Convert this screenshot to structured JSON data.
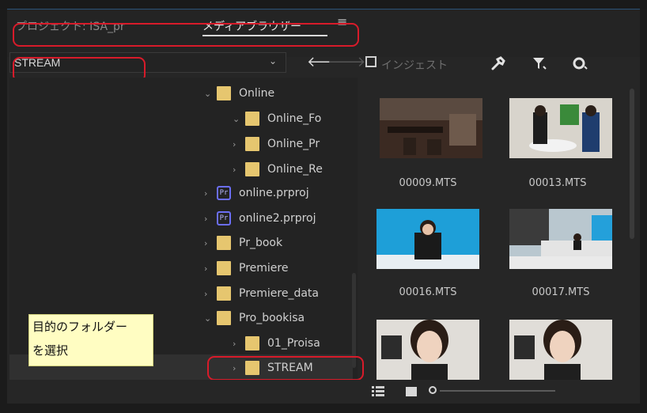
{
  "tabs": {
    "project": "プロジェクト: ISA_pr",
    "media_browser": "メディアブラウザー"
  },
  "toolbar": {
    "path_value": "STREAM",
    "ingest_label": "インジェスト",
    "menu_icon": "hamburger-menu-icon",
    "back_icon": "arrow-left-icon",
    "forward_icon": "arrow-right-icon",
    "wrench_icon": "wrench-icon",
    "filter_icon": "filter-icon",
    "view_icon": "eye-icon"
  },
  "tree": [
    {
      "label": "Online",
      "type": "folder",
      "expanded": true
    },
    {
      "label": "Online_Fo",
      "type": "folder",
      "expanded": true
    },
    {
      "label": "Online_Pr",
      "type": "folder",
      "expanded": false
    },
    {
      "label": "Online_Re",
      "type": "folder",
      "expanded": false
    },
    {
      "label": "online.prproj",
      "type": "project",
      "expanded": false
    },
    {
      "label": "online2.prproj",
      "type": "project",
      "expanded": false
    },
    {
      "label": "Pr_book",
      "type": "folder",
      "expanded": false
    },
    {
      "label": "Premiere",
      "type": "folder",
      "expanded": false
    },
    {
      "label": "Premiere_data",
      "type": "folder",
      "expanded": false
    },
    {
      "label": "Pro_bookisa",
      "type": "folder",
      "expanded": true
    },
    {
      "label": "01_Proisa",
      "type": "folder",
      "expanded": false
    },
    {
      "label": "STREAM",
      "type": "folder",
      "expanded": false,
      "selected": true
    }
  ],
  "pr_badge": "Pr",
  "thumbnails": [
    {
      "label": "00009.MTS"
    },
    {
      "label": "00013.MTS"
    },
    {
      "label": "00016.MTS"
    },
    {
      "label": "00017.MTS"
    },
    {
      "label": ""
    },
    {
      "label": ""
    }
  ],
  "note": {
    "line1": "目的のフォルダー",
    "line2": "を選択"
  },
  "colors": {
    "highlight_red": "#d81b2a",
    "folder_yellow": "#e6c66f",
    "note_bg": "#fffdc2"
  }
}
